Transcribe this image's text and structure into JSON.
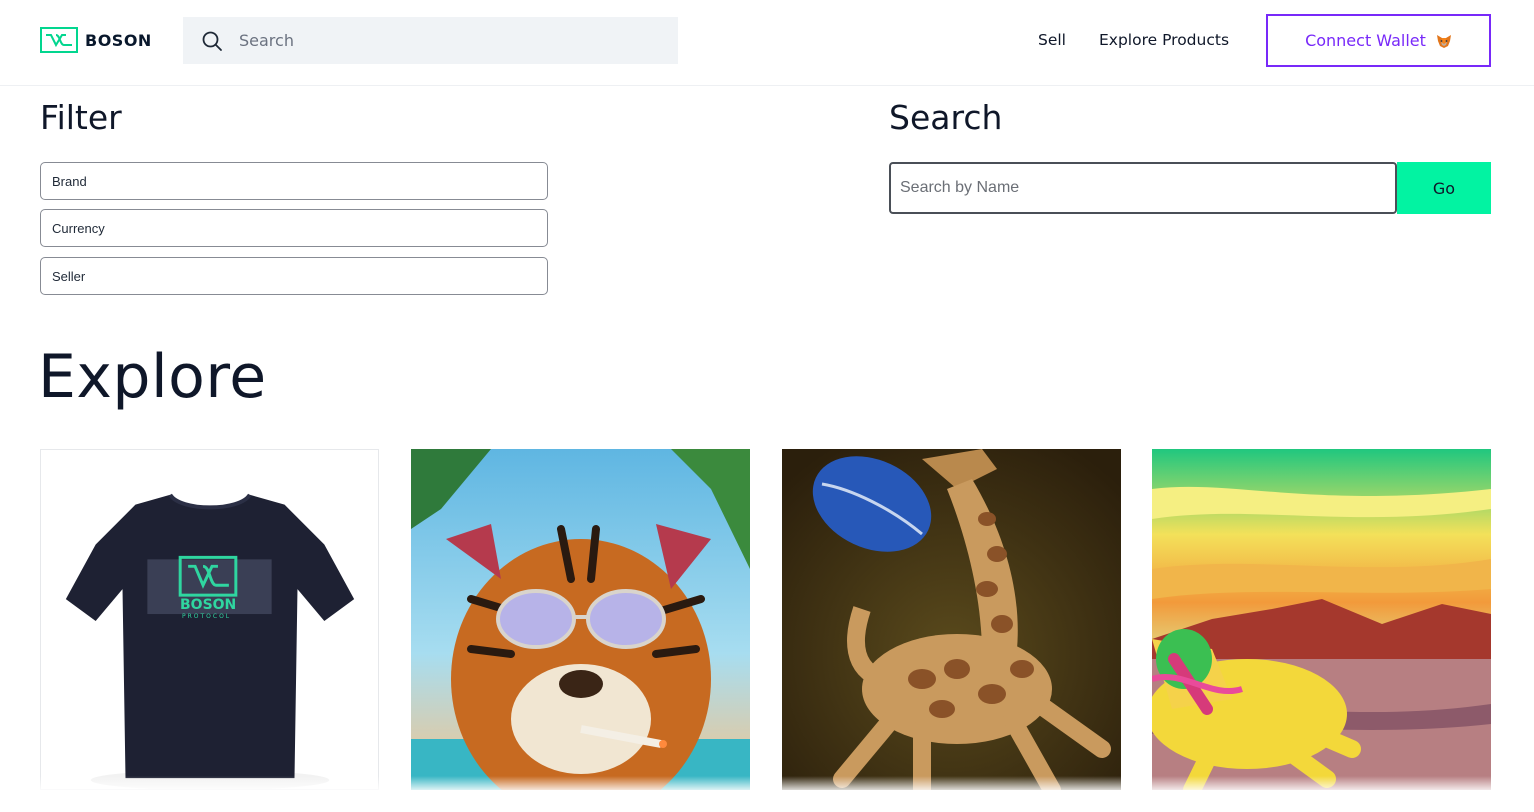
{
  "header": {
    "logo_text": "BOSON",
    "search_placeholder": "Search",
    "nav": {
      "sell": "Sell",
      "explore_products": "Explore Products"
    },
    "connect_wallet": "Connect Wallet"
  },
  "filter": {
    "title": "Filter",
    "fields": [
      "Brand",
      "Currency",
      "Seller"
    ]
  },
  "search": {
    "title": "Search",
    "placeholder": "Search by Name",
    "go_label": "Go"
  },
  "explore": {
    "title": "Explore",
    "products": [
      {
        "image": "boson-tshirt",
        "print_text": "BOSON",
        "print_subtext": "PROTOCOL"
      },
      {
        "image": "tiger-sunglasses-art"
      },
      {
        "image": "giraffe-football-art"
      },
      {
        "image": "horse-rider-desert-art"
      }
    ]
  },
  "colors": {
    "brand_green": "#02f3a2",
    "accent_purple": "#7829f9",
    "text_dark": "#0f1729",
    "search_bg": "#f0f3f6"
  }
}
